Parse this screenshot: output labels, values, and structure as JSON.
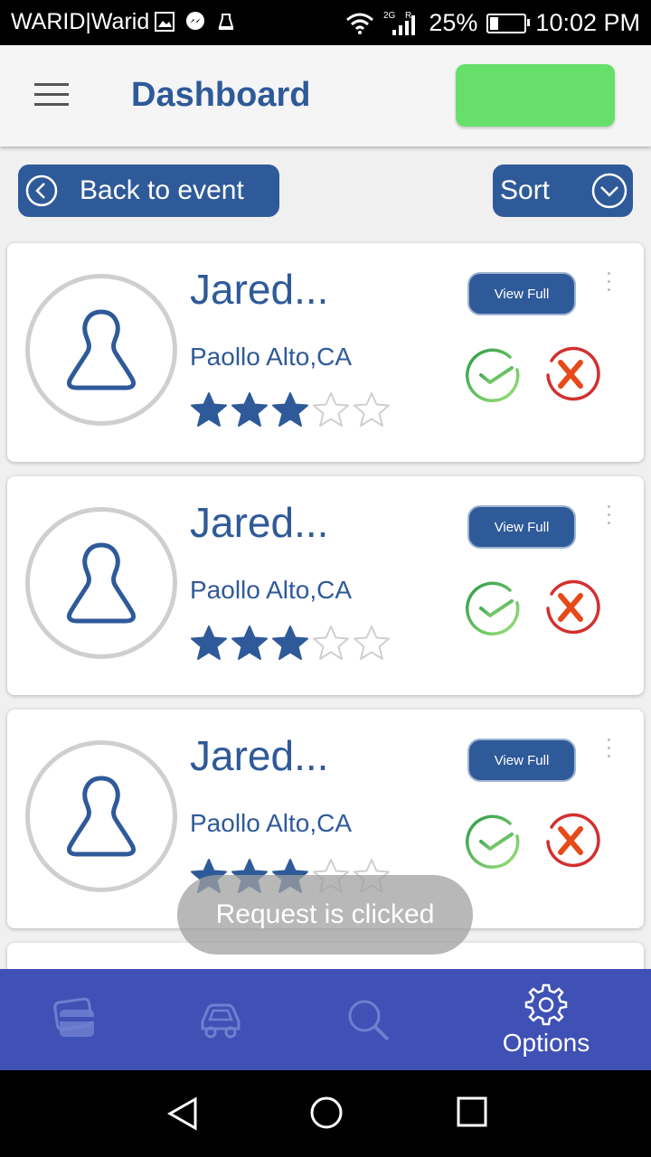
{
  "status_bar": {
    "carrier": "WARID|Warid",
    "network": "2G",
    "roaming": "R",
    "battery": "25%",
    "battery_level": 0.25,
    "time": "10:02 PM",
    "icons": [
      "image-icon",
      "messenger-icon",
      "notification-icon",
      "wifi-icon",
      "signal-icon",
      "battery-icon"
    ]
  },
  "app_bar": {
    "title": "Dashboard",
    "menu_icon": "hamburger-icon",
    "accent_button_color": "#66e06b"
  },
  "actions": {
    "back_label": "Back to event",
    "sort_label": "Sort"
  },
  "requests": [
    {
      "name": "Jared...",
      "location": "Paollo Alto,CA",
      "rating": 3,
      "rating_max": 5,
      "view_label": "View Full"
    },
    {
      "name": "Jared...",
      "location": "Paollo Alto,CA",
      "rating": 3,
      "rating_max": 5,
      "view_label": "View Full"
    },
    {
      "name": "Jared...",
      "location": "Paollo Alto,CA",
      "rating": 3,
      "rating_max": 5,
      "view_label": "View Full"
    }
  ],
  "toast": "Request is clicked",
  "bottom_nav": {
    "items": [
      {
        "icon": "cards-icon",
        "label": ""
      },
      {
        "icon": "car-icon",
        "label": ""
      },
      {
        "icon": "search-icon",
        "label": ""
      },
      {
        "icon": "gear-icon",
        "label": "Options",
        "active": true
      }
    ]
  },
  "colors": {
    "primary": "#2f5a99",
    "nav": "#3f51b5",
    "accept": "#4caf50",
    "reject": "#d32f2f"
  }
}
